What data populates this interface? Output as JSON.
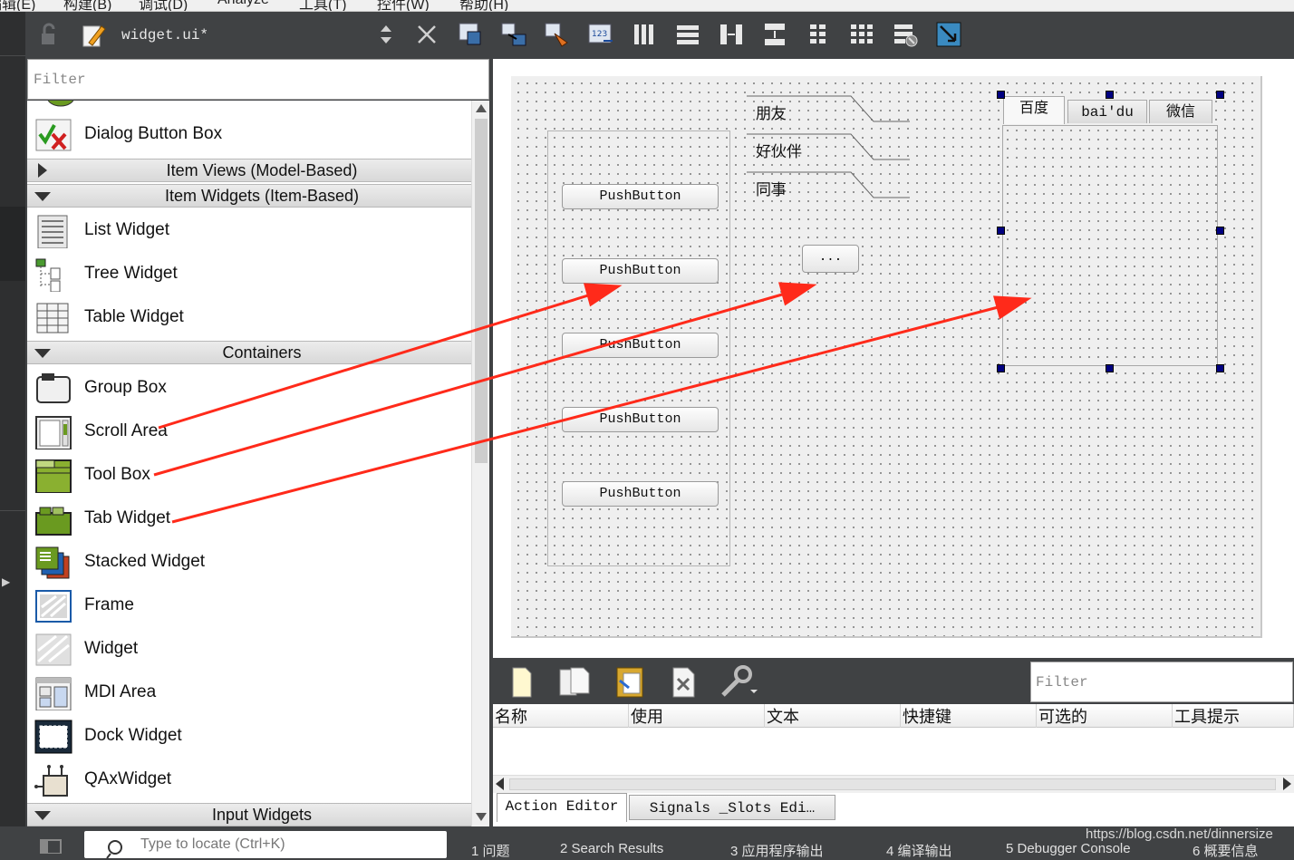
{
  "menubar": {
    "items": [
      "编辑(E)",
      "构建(B)",
      "调试(D)",
      "Analyze",
      "工具(T)",
      "控件(W)",
      "帮助(H)"
    ]
  },
  "toolbar": {
    "file_name": "widget.ui*"
  },
  "widget_box": {
    "filter_placeholder": "Filter",
    "items": [
      {
        "type": "item",
        "label": "Dialog Button Box",
        "icon": "dialog-button-box-icon"
      },
      {
        "type": "category",
        "label": "Item Views (Model-Based)",
        "expanded": false
      },
      {
        "type": "category",
        "label": "Item Widgets (Item-Based)",
        "expanded": true
      },
      {
        "type": "item",
        "label": "List Widget",
        "icon": "list-widget-icon"
      },
      {
        "type": "item",
        "label": "Tree Widget",
        "icon": "tree-widget-icon"
      },
      {
        "type": "item",
        "label": "Table Widget",
        "icon": "table-widget-icon"
      },
      {
        "type": "category",
        "label": "Containers",
        "expanded": true
      },
      {
        "type": "item",
        "label": "Group Box",
        "icon": "group-box-icon"
      },
      {
        "type": "item",
        "label": "Scroll Area",
        "icon": "scroll-area-icon"
      },
      {
        "type": "item",
        "label": "Tool Box",
        "icon": "tool-box-icon"
      },
      {
        "type": "item",
        "label": "Tab Widget",
        "icon": "tab-widget-icon"
      },
      {
        "type": "item",
        "label": "Stacked Widget",
        "icon": "stacked-widget-icon"
      },
      {
        "type": "item",
        "label": "Frame",
        "icon": "frame-icon"
      },
      {
        "type": "item",
        "label": "Widget",
        "icon": "widget-icon"
      },
      {
        "type": "item",
        "label": "MDI Area",
        "icon": "mdi-area-icon"
      },
      {
        "type": "item",
        "label": "Dock Widget",
        "icon": "dock-widget-icon"
      },
      {
        "type": "item",
        "label": "QAxWidget",
        "icon": "qaxwidget-icon"
      },
      {
        "type": "category",
        "label": "Input Widgets",
        "expanded": true
      }
    ]
  },
  "form": {
    "push_buttons": [
      "PushButton",
      "PushButton",
      "PushButton",
      "PushButton",
      "PushButton"
    ],
    "toolbox_tabs": [
      "朋友",
      "好伙伴",
      "同事"
    ],
    "tool_button": "...",
    "tab_widget_tabs": [
      "百度",
      "bai'du",
      "微信"
    ],
    "selected_tab": 0
  },
  "action_editor": {
    "filter_placeholder": "Filter",
    "columns": [
      "名称",
      "使用",
      "文本",
      "快捷键",
      "可选的",
      "工具提示"
    ],
    "tabs": [
      "Action Editor",
      "Signals _Slots Edi…"
    ]
  },
  "statusbar": {
    "locator_placeholder": "Type to locate (Ctrl+K)",
    "panes": [
      "1  问题",
      "2  Search Results",
      "3  应用程序输出",
      "4  编译输出",
      "5  Debugger Console",
      "6  概要信息"
    ]
  },
  "watermark": "https://blog.csdn.net/dinnersize",
  "colors": {
    "arrow": "#ff2a1a",
    "handle": "#000080",
    "dark_bg": "#404244"
  }
}
